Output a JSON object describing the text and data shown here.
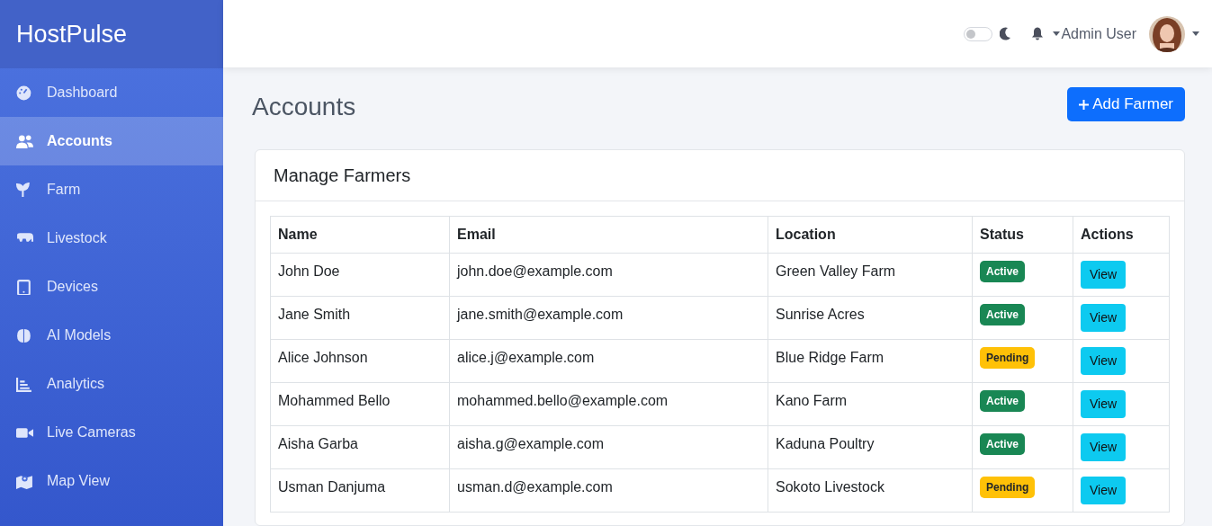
{
  "brand": "HostPulse",
  "sidebar": {
    "items": [
      {
        "label": "Dashboard",
        "selected": false
      },
      {
        "label": "Accounts",
        "selected": true
      },
      {
        "label": "Farm",
        "selected": false
      },
      {
        "label": "Livestock",
        "selected": false
      },
      {
        "label": "Devices",
        "selected": false
      },
      {
        "label": "AI Models",
        "selected": false
      },
      {
        "label": "Analytics",
        "selected": false
      },
      {
        "label": "Live Cameras",
        "selected": false
      },
      {
        "label": "Map View",
        "selected": false
      }
    ]
  },
  "topbar": {
    "dark_mode_toggle": {
      "on": false
    },
    "user_name": "Admin User"
  },
  "page_title": "Accounts",
  "add_button": "Add Farmer",
  "card": {
    "title": "Manage Farmers",
    "table": {
      "columns": [
        "Name",
        "Email",
        "Location",
        "Status",
        "Actions"
      ],
      "rows": [
        {
          "name": "John Doe",
          "email": "john.doe@example.com",
          "location": "Green Valley Farm",
          "status": "Active",
          "kind": "active",
          "action": "View"
        },
        {
          "name": "Jane Smith",
          "email": "jane.smith@example.com",
          "location": "Sunrise Acres",
          "status": "Active",
          "kind": "active",
          "action": "View"
        },
        {
          "name": "Alice Johnson",
          "email": "alice.j@example.com",
          "location": "Blue Ridge Farm",
          "status": "Pending",
          "kind": "pending",
          "action": "View"
        },
        {
          "name": "Mohammed Bello",
          "email": "mohammed.bello@example.com",
          "location": "Kano Farm",
          "status": "Active",
          "kind": "active",
          "action": "View"
        },
        {
          "name": "Aisha Garba",
          "email": "aisha.g@example.com",
          "location": "Kaduna Poultry",
          "status": "Active",
          "kind": "active",
          "action": "View"
        },
        {
          "name": "Usman Danjuma",
          "email": "usman.d@example.com",
          "location": "Sokoto Livestock",
          "status": "Pending",
          "kind": "pending",
          "action": "View"
        }
      ]
    }
  }
}
